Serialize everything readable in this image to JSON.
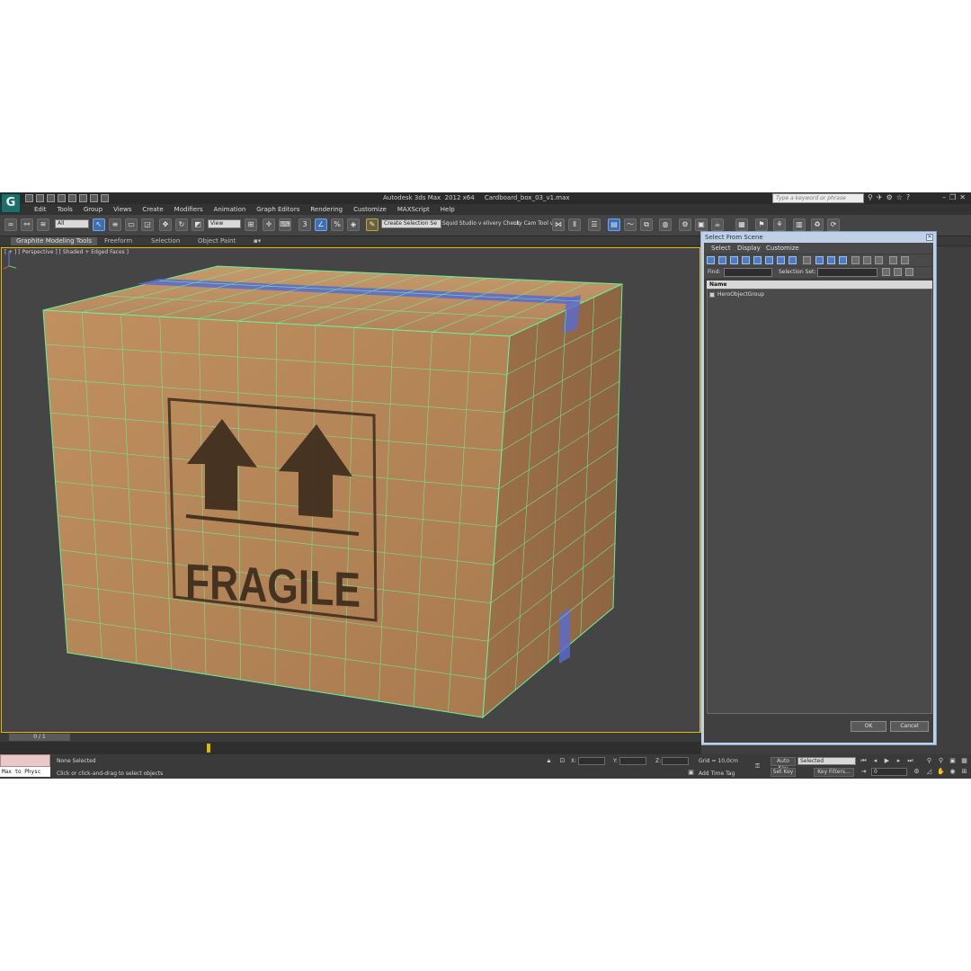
{
  "window": {
    "title": "Autodesk 3ds Max  2012 x64     Cardboard_box_03_v1.max",
    "search_placeholder": "Type a keyword or phrase"
  },
  "menu": [
    "Edit",
    "Tools",
    "Group",
    "Views",
    "Create",
    "Modifiers",
    "Animation",
    "Graph Editors",
    "Rendering",
    "Customize",
    "MAXScript",
    "Help"
  ],
  "toolbar": {
    "filter_dropdown": "All",
    "refcoord_dropdown": "View",
    "named_selection": "Create Selection Se",
    "text1": "Squid Studio v elivery Check",
    "text2": "uty Cam Tool v"
  },
  "ribbon_tabs": [
    "Graphite Modeling Tools",
    "Freeform",
    "Selection",
    "Object Paint"
  ],
  "viewport": {
    "label": "[ + ] [ Perspective ] [ Shaded + Edged Faces ]",
    "box_text": "FRAGILE"
  },
  "dialog": {
    "title": "Select From Scene",
    "menu": [
      "Select",
      "Display",
      "Customize"
    ],
    "find_label": "Find:",
    "selection_set_label": "Selection Set:",
    "column_name": "Name",
    "items": [
      "HeroObjectGroup"
    ],
    "ok": "OK",
    "cancel": "Cancel"
  },
  "timeline": {
    "frame": "0 / 1"
  },
  "status": {
    "maxscript_text": "Max to Physc",
    "selection": "None Selected",
    "prompt": "Click or click-and-drag to select objects",
    "x_label": "X:",
    "y_label": "Y:",
    "z_label": "Z:",
    "grid": "Grid = 10,0cm",
    "add_time_tag": "Add Time Tag",
    "auto_key": "Auto Key",
    "auto_key_dropdown": "Selected",
    "set_key": "Set Key",
    "key_filters": "Key Filters...",
    "frame_field": "0"
  },
  "colors": {
    "viewport_bg": "#454545",
    "cardboard": "#b8875a",
    "wire": "#6cf09a",
    "tape": "#5a6ad0",
    "active_border": "#e0b800"
  }
}
